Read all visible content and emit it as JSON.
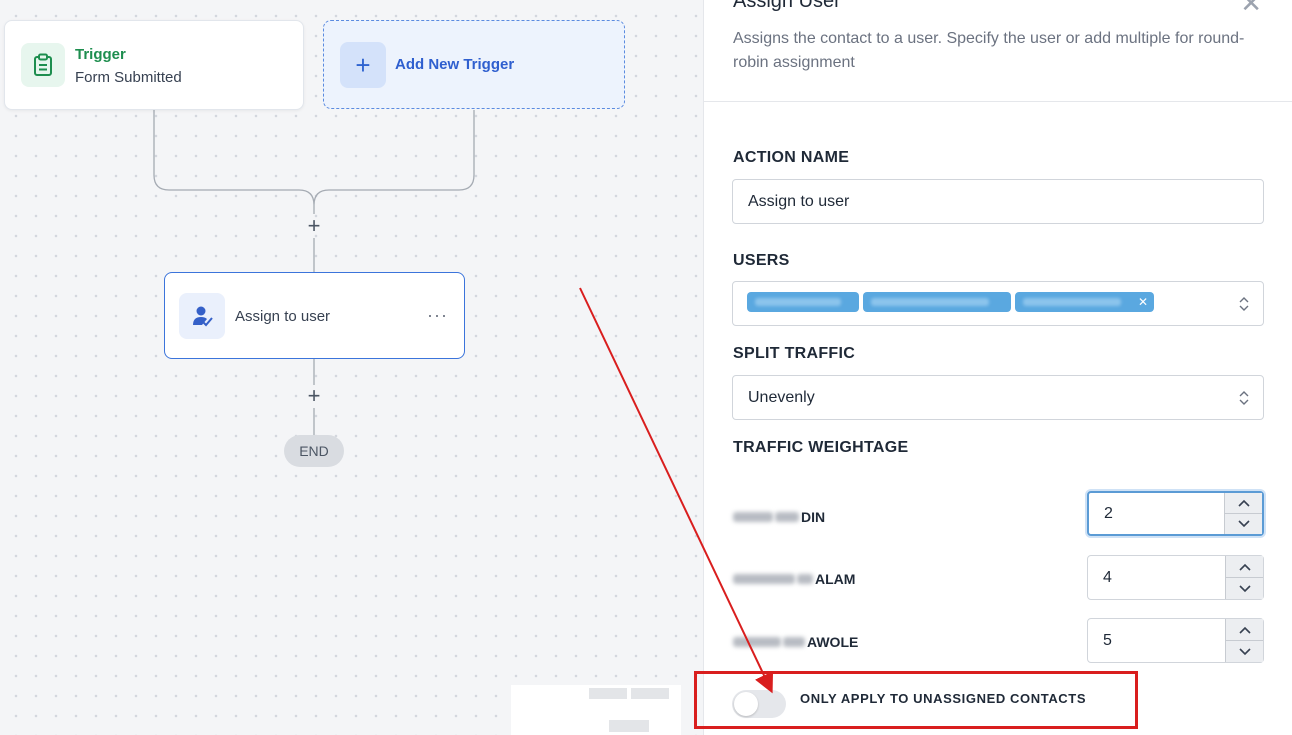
{
  "canvas": {
    "trigger": {
      "title": "Trigger",
      "subtitle": "Form Submitted",
      "icon": "clipboard-icon"
    },
    "add_trigger": {
      "label": "Add New Trigger",
      "icon_char": "+"
    },
    "plus_char": "+",
    "action": {
      "label": "Assign to user",
      "more": "···",
      "icon": "user-check-icon"
    },
    "end_label": "END"
  },
  "panel": {
    "title": "Assign User",
    "close_char": "✕",
    "description": "Assigns the contact to a user. Specify the user or add multiple for round-robin assignment",
    "action_name": {
      "label": "ACTION NAME",
      "value": "Assign to user"
    },
    "users": {
      "label": "USERS",
      "chip_remove": "✕"
    },
    "split_traffic": {
      "label": "SPLIT TRAFFIC",
      "value": "Unevenly"
    },
    "traffic_weightage": {
      "label": "TRAFFIC WEIGHTAGE",
      "rows": [
        {
          "name_suffix": "DIN",
          "value": "2"
        },
        {
          "name_suffix": "ALAM",
          "value": "4"
        },
        {
          "name_suffix": "AWOLE",
          "value": "5"
        }
      ]
    },
    "unassigned_toggle": {
      "label": "ONLY APPLY TO UNASSIGNED CONTACTS",
      "on": false
    }
  },
  "spinner": {
    "up": "⌃",
    "down": "⌄"
  },
  "colors": {
    "annotation": "#d91e1e",
    "accent": "#3b74db",
    "trigger_green": "#1e8e4f"
  }
}
